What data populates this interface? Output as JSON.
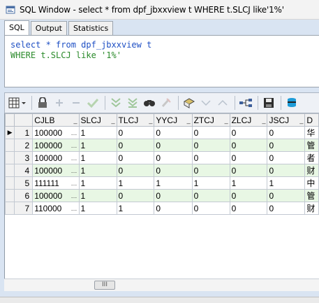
{
  "window": {
    "title": "SQL Window - select * from dpf_jbxxview t WHERE t.SLCJ like'1%'"
  },
  "tabs": [
    {
      "label": "SQL",
      "active": true
    },
    {
      "label": "Output",
      "active": false
    },
    {
      "label": "Statistics",
      "active": false
    }
  ],
  "editor": {
    "line1": {
      "kw1": "select",
      "rest": " * ",
      "kw2": "from",
      "rest2": " dpf_jbxxview t"
    },
    "line2": {
      "text": "WHERE t.SLCJ like ",
      "str": "'1%'"
    }
  },
  "toolbar": {
    "icons": [
      "grid-select-icon",
      "lock-icon",
      "add-record-icon",
      "delete-record-icon",
      "post-record-icon",
      "fetch-next-icon",
      "fetch-last-icon",
      "find-icon",
      "clear-icon",
      "query-by-example-icon",
      "sort-desc-icon",
      "sort-asc-icon",
      "link-icon",
      "save-icon",
      "export-icon"
    ]
  },
  "grid": {
    "columns": [
      "CJLB",
      "SLCJ",
      "TLCJ",
      "YYCJ",
      "ZTCJ",
      "ZLCJ",
      "JSCJ",
      "D"
    ],
    "rows": [
      {
        "num": "1",
        "current": true,
        "cells": [
          "100000",
          "1",
          "0",
          "0",
          "0",
          "0",
          "0",
          "华"
        ]
      },
      {
        "num": "2",
        "current": false,
        "cells": [
          "100000",
          "1",
          "0",
          "0",
          "0",
          "0",
          "0",
          "管"
        ]
      },
      {
        "num": "3",
        "current": false,
        "cells": [
          "100000",
          "1",
          "0",
          "0",
          "0",
          "0",
          "0",
          "者"
        ]
      },
      {
        "num": "4",
        "current": false,
        "cells": [
          "100000",
          "1",
          "0",
          "0",
          "0",
          "0",
          "0",
          "财"
        ]
      },
      {
        "num": "5",
        "current": false,
        "cells": [
          "111111",
          "1",
          "1",
          "1",
          "1",
          "1",
          "1",
          "中"
        ]
      },
      {
        "num": "6",
        "current": false,
        "cells": [
          "100000",
          "1",
          "0",
          "0",
          "0",
          "0",
          "0",
          "管"
        ]
      },
      {
        "num": "7",
        "current": false,
        "cells": [
          "110000",
          "1",
          "1",
          "0",
          "0",
          "0",
          "0",
          "财"
        ]
      }
    ],
    "ellipsis": "…"
  },
  "scrollbar": {
    "thumb_label": "III"
  }
}
